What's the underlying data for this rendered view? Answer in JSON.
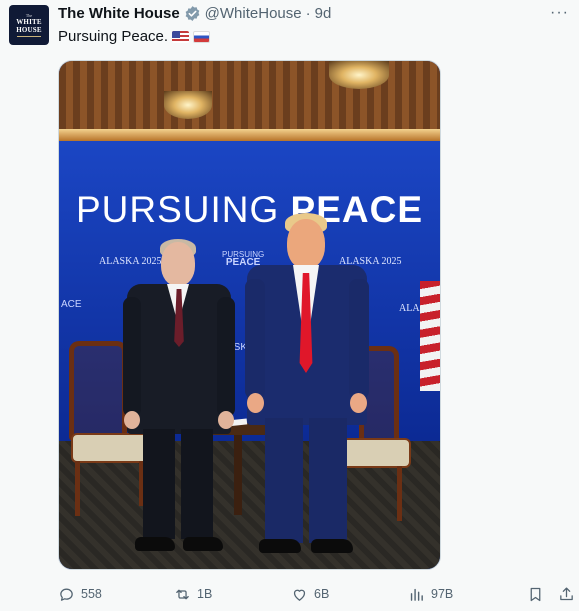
{
  "account": {
    "name": "The White House",
    "handle": "@WhiteHouse",
    "separator": "·",
    "time": "9d",
    "avatar_lines": [
      "The",
      "WHITE",
      "HOUSE"
    ],
    "verified_color": "#829aab"
  },
  "menu": {
    "more_icon": "more-dots-icon"
  },
  "post": {
    "text": "Pursuing Peace.",
    "flags": [
      "us-flag-emoji",
      "russia-flag-emoji"
    ]
  },
  "photo": {
    "banner_word1": "PURSUING",
    "banner_word2": "PEACE",
    "labels": {
      "alaska_left": "ALASKA 2025",
      "alaska_right": "ALASKA 2025",
      "logo_top": "PURSUING",
      "logo_bottom": "PEACE",
      "edge_left": "ACE",
      "edge_right": "ALASKA",
      "middle": "ASKA"
    }
  },
  "actions": {
    "reply_count": "558",
    "repost_count": "1B",
    "like_count": "6B",
    "views_count": "97B"
  },
  "colors": {
    "text_secondary": "#536471",
    "backdrop_blue": "#1b46c4"
  }
}
